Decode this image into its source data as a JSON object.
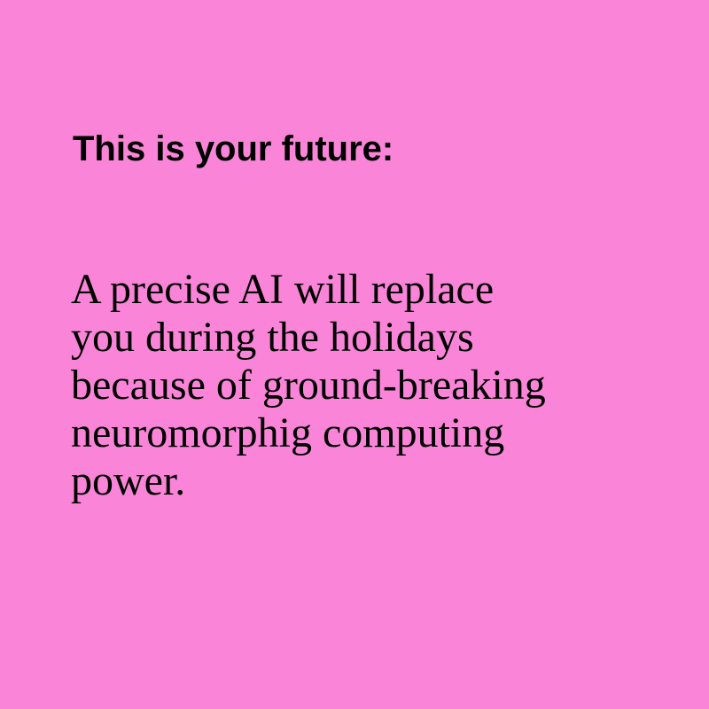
{
  "colors": {
    "background": "#fa85d8",
    "text": "#000000"
  },
  "card": {
    "heading": "This is your future:",
    "body_lines": [
      "A precise AI will replace",
      "you during the holidays",
      "because of ground-breaking",
      "neuromorphig computing",
      "power."
    ]
  }
}
